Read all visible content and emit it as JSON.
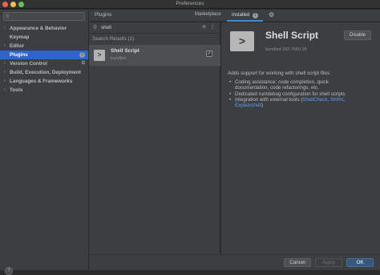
{
  "window": {
    "title": "Preferences"
  },
  "sidebar": {
    "search_placeholder": "",
    "items": [
      {
        "label": "Appearance & Behavior",
        "arrow": "›",
        "selected": false
      },
      {
        "label": "Keymap",
        "arrow": "",
        "selected": false
      },
      {
        "label": "Editor",
        "arrow": "›",
        "selected": false
      },
      {
        "label": "Plugins",
        "arrow": "",
        "selected": true,
        "badge": "1"
      },
      {
        "label": "Version Control",
        "arrow": "›",
        "selected": false,
        "icon": "copy-icon"
      },
      {
        "label": "Build, Execution, Deployment",
        "arrow": "›",
        "selected": false
      },
      {
        "label": "Languages & Frameworks",
        "arrow": "›",
        "selected": false
      },
      {
        "label": "Tools",
        "arrow": "›",
        "selected": false
      }
    ]
  },
  "header": {
    "title": "Plugins",
    "tabs": [
      {
        "label": "Marketplace",
        "active": false
      },
      {
        "label": "Installed",
        "active": true,
        "count": "1"
      }
    ]
  },
  "middle": {
    "search_value": "shell",
    "results_label": "Search Results (1)",
    "plugins": [
      {
        "name": "Shell Script",
        "sub": "bundled",
        "enabled": true,
        "check": "✓",
        "icon_glyph": ">"
      }
    ]
  },
  "detail": {
    "icon_glyph": ">",
    "name": "Shell Script",
    "disable_label": "Disable",
    "version": "bundled 202.7660.26",
    "description": "Adds support for working with shell script files",
    "bullets": {
      "b1_line1": "Coding assistance: code completion, quick",
      "b1_line2": "documentation, code refactorings, etc.",
      "b2": "Dedicated run/debug configuration for shell scripts",
      "b3_prefix": "Integration with external tools (",
      "b3_link1": "ShellCheck",
      "b3_sep": ", ",
      "b3_link2": "Shfmt",
      "b3_sep2": ",",
      "b3_link3": "Explainshell",
      "b3_suffix": ")"
    }
  },
  "footer": {
    "help_label": "?",
    "cancel_label": "Cancel",
    "apply_label": "Apply",
    "ok_label": "OK"
  },
  "colors": {
    "accent": "#2f65ca",
    "link": "#589df6",
    "ok_button": "#365880"
  }
}
